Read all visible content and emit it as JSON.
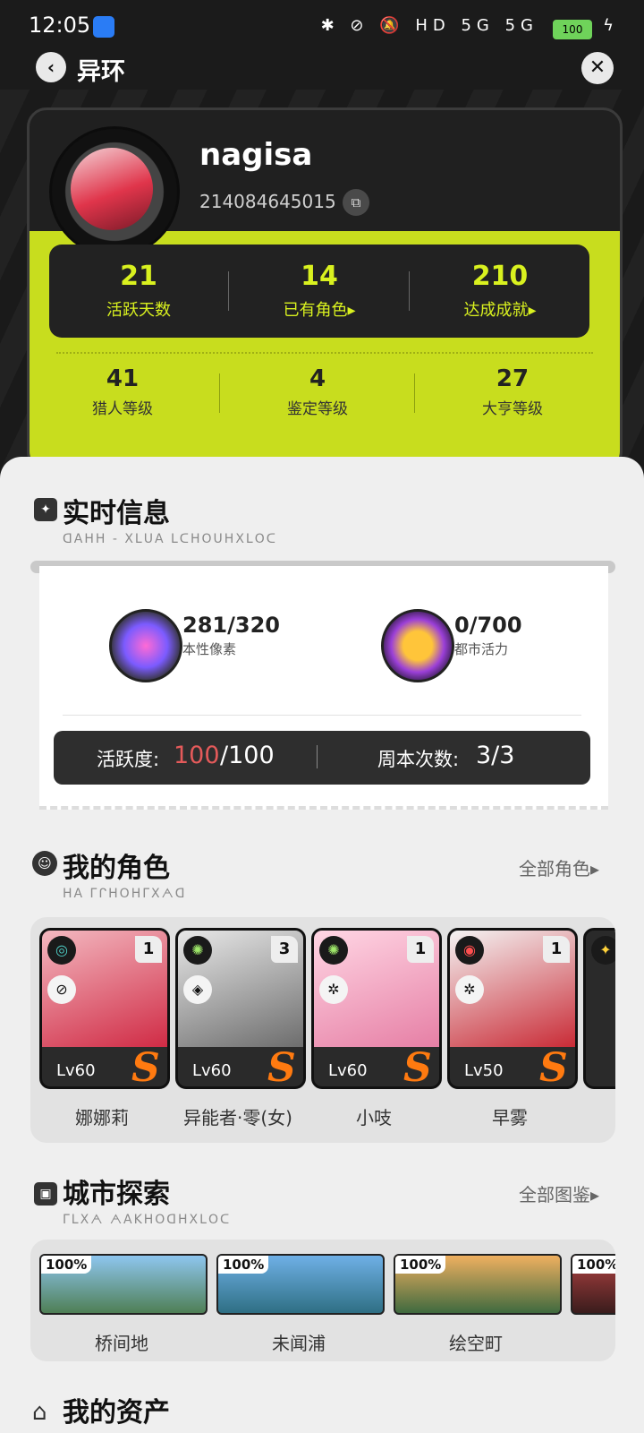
{
  "status_bar": {
    "time": "12:05",
    "icons": "✱ ⊘ 🔕 HD 5G 5G",
    "battery": "100"
  },
  "header": {
    "title": "异环"
  },
  "profile": {
    "name": "nagisa",
    "id": "214084645015",
    "stats_main": [
      {
        "value": "21",
        "label": "活跃天数"
      },
      {
        "value": "14",
        "label": "已有角色▸"
      },
      {
        "value": "210",
        "label": "达成成就▸"
      }
    ],
    "stats_sub": [
      {
        "value": "41",
        "label": "猎人等级"
      },
      {
        "value": "4",
        "label": "鉴定等级"
      },
      {
        "value": "27",
        "label": "大亨等级"
      }
    ]
  },
  "realtime": {
    "title": "实时信息",
    "subtitle": "ᗡAᕼᕼ - XᒪᑌA ᒪᑕᕼOᑌᕼXᒪOᑕ",
    "resources": [
      {
        "value": "281/320",
        "label": "本性像素"
      },
      {
        "value": "0/700",
        "label": "都市活力"
      }
    ],
    "activity_label": "活跃度:",
    "activity_current": "100",
    "activity_total": "/100",
    "weekly_label": "周本次数:",
    "weekly_value": "3/3"
  },
  "characters": {
    "title": "我的角色",
    "subtitle": "ᕼA ᒥᒋᕼOᕼᒥXᗅᗡ",
    "link": "全部角色▸",
    "items": [
      {
        "name": "娜娜莉",
        "level": "Lv60",
        "count": "1",
        "rank": "S",
        "color_a": "#f3b8c0",
        "color_b": "#d02b45"
      },
      {
        "name": "异能者·零(女)",
        "level": "Lv60",
        "count": "3",
        "rank": "S",
        "color_a": "#e8e8e8",
        "color_b": "#6d6d6d"
      },
      {
        "name": "小吱",
        "level": "Lv60",
        "count": "1",
        "rank": "S",
        "color_a": "#ffd6e4",
        "color_b": "#e67fa5"
      },
      {
        "name": "早雾",
        "level": "Lv50",
        "count": "1",
        "rank": "S",
        "color_a": "#f4f4f4",
        "color_b": "#c92b36"
      }
    ]
  },
  "city": {
    "title": "城市探索",
    "subtitle": "ᒥᒪXᗅ ᗅAKᕼOᗡᕼXᒪOᑕ",
    "link": "全部图鉴▸",
    "items": [
      {
        "name": "桥间地",
        "percent": "100%",
        "color_a": "#8ec6ef",
        "color_b": "#4f7f55"
      },
      {
        "name": "未闻浦",
        "percent": "100%",
        "color_a": "#6fb0e6",
        "color_b": "#2f6f84"
      },
      {
        "name": "绘空町",
        "percent": "100%",
        "color_a": "#efb060",
        "color_b": "#3f6a3f"
      },
      {
        "percent": "100%",
        "color_a": "#b04242",
        "color_b": "#3a1c1c"
      }
    ]
  },
  "assets": {
    "title": "我的资产"
  },
  "colors": {
    "lime": "#c8dd1e",
    "stat_yellow": "#d9f11f",
    "rank_orange": "#ff7a10",
    "activity_red": "#e45a5a"
  }
}
